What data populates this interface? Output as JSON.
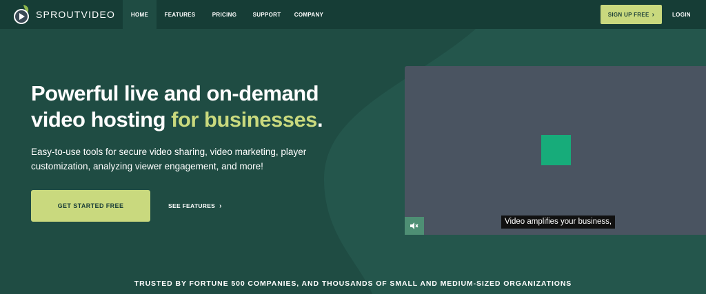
{
  "brand": {
    "name": "SPROUTVIDEO"
  },
  "nav": {
    "items": [
      {
        "label": "HOME",
        "active": true
      },
      {
        "label": "FEATURES",
        "active": false
      },
      {
        "label": "PRICING",
        "active": false
      },
      {
        "label": "SUPPORT",
        "active": false
      },
      {
        "label": "COMPANY",
        "active": false
      }
    ],
    "signup_label": "SIGN UP FREE",
    "login_label": "LOGIN"
  },
  "hero": {
    "headline_line1": "Powerful live and on-demand",
    "headline_line2_start": "video hosting ",
    "headline_accent": "for businesses",
    "headline_end": ".",
    "subtext": "Easy-to-use tools for secure video sharing, video marketing, player customization, analyzing viewer engagement, and more!",
    "cta_label": "GET STARTED FREE",
    "features_link_label": "SEE FEATURES"
  },
  "video": {
    "caption": "Video amplifies your business,",
    "mute_icon": "speaker-muted-icon"
  },
  "trusted_text": "TRUSTED BY FORTUNE 500 COMPANIES, AND THOUSANDS OF SMALL AND MEDIUM-SIZED ORGANIZATIONS",
  "colors": {
    "header_bg": "#163d36",
    "page_bg": "#1f4c43",
    "accent": "#c9d97e",
    "video_bg": "#4a5461",
    "video_square": "#17ac7a",
    "mute_bg": "#4e8f74"
  }
}
